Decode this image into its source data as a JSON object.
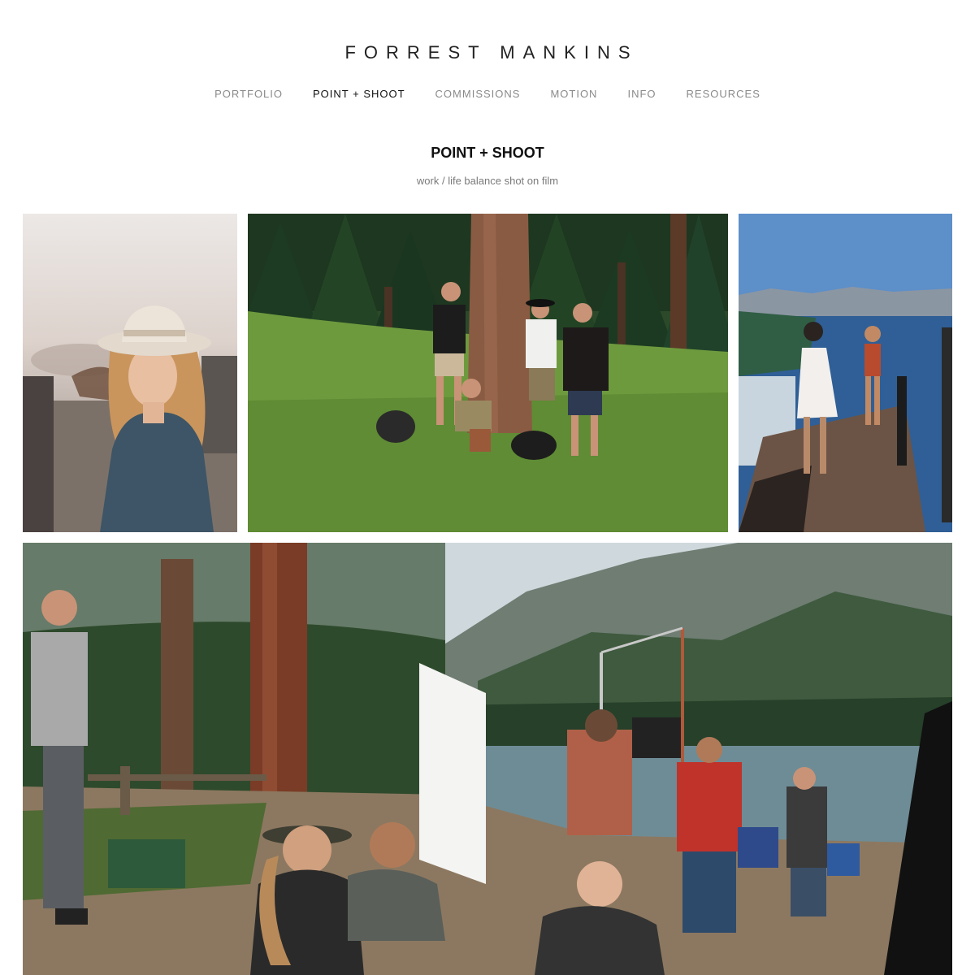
{
  "site": {
    "title": "FORREST MANKINS"
  },
  "nav": {
    "items": [
      {
        "label": "PORTFOLIO"
      },
      {
        "label": "POINT + SHOOT"
      },
      {
        "label": "COMMISSIONS"
      },
      {
        "label": "MOTION"
      },
      {
        "label": "INFO"
      },
      {
        "label": "RESOURCES"
      }
    ],
    "active_index": 1
  },
  "page": {
    "title": "POINT + SHOOT",
    "subtitle": "work / life balance shot on film"
  },
  "gallery": {
    "photos": [
      {
        "subject": "woman in wide-brim hat at a dusty ranch"
      },
      {
        "subject": "five men posing around a pine tree in a meadow"
      },
      {
        "subject": "two women on a dock by a mountain lake"
      },
      {
        "subject": "film crew on a lakeshore with mountains"
      }
    ]
  },
  "colors": {
    "background": "#ffffff",
    "nav_active": "#111111",
    "nav_inactive": "#8a8a8a"
  }
}
